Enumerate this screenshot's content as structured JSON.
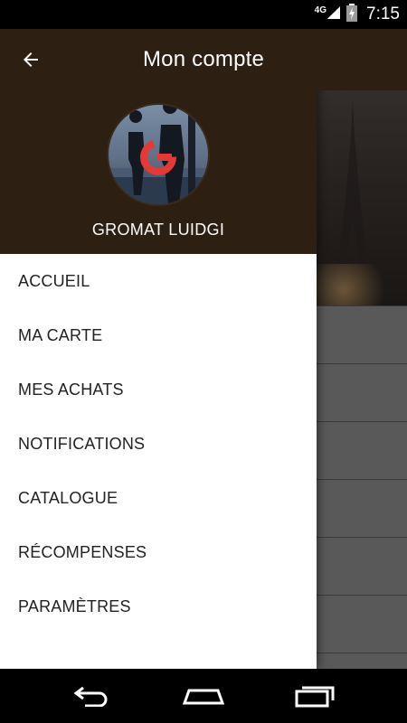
{
  "status_bar": {
    "network": "4G",
    "time": "7:15"
  },
  "app_bar": {
    "title": "Mon compte",
    "back_icon": "arrow-back-icon"
  },
  "drawer": {
    "user_name": "GROMAT LUIDGI",
    "menu": [
      {
        "label": "ACCUEIL"
      },
      {
        "label": "MA CARTE"
      },
      {
        "label": "MES ACHATS"
      },
      {
        "label": "NOTIFICATIONS"
      },
      {
        "label": "CATALOGUE"
      },
      {
        "label": "RÉCOMPENSES"
      },
      {
        "label": "PARAMÈTRES"
      }
    ]
  },
  "colors": {
    "header_brown": "#2e1f13",
    "accent_red": "#e53935"
  },
  "nav_bar": {
    "icons": [
      "back-nav-icon",
      "home-nav-icon",
      "recents-nav-icon"
    ]
  }
}
